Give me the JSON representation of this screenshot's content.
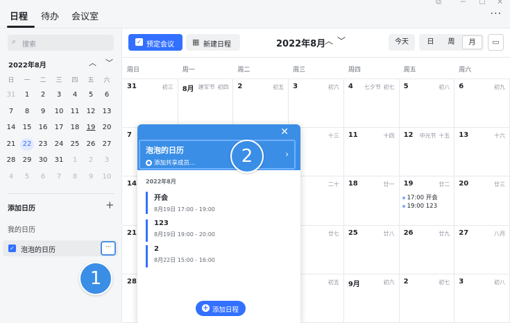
{
  "topbar": {
    "tabs": [
      "日程",
      "待办",
      "会议室"
    ],
    "more_label": "···"
  },
  "sidebar": {
    "search_placeholder": "搜索",
    "mini_month": "2022年8月",
    "weekdays": [
      "日",
      "一",
      "二",
      "三",
      "四",
      "五",
      "六"
    ],
    "weeks": [
      [
        "31",
        "1",
        "2",
        "3",
        "4",
        "5",
        "6"
      ],
      [
        "7",
        "8",
        "9",
        "10",
        "11",
        "12",
        "13"
      ],
      [
        "14",
        "15",
        "16",
        "17",
        "18",
        "19",
        "20"
      ],
      [
        "21",
        "22",
        "23",
        "24",
        "25",
        "26",
        "27"
      ],
      [
        "28",
        "29",
        "30",
        "31",
        "1",
        "2",
        "3"
      ],
      [
        "4",
        "5",
        "6",
        "7",
        "8",
        "9",
        "10"
      ]
    ],
    "selected_day": "22",
    "add_calendar_label": "添加日历",
    "my_calendars_label": "我的日历",
    "calendar_item": {
      "name": "泡泡的日历",
      "more": "···"
    }
  },
  "toolbar": {
    "book_meeting_label": "预定会议",
    "new_event_label": "新建日程",
    "month_title": "2022年8月",
    "today_label": "今天",
    "views": [
      "日",
      "周",
      "月"
    ],
    "active_view": "月"
  },
  "grid": {
    "weekday_headers": [
      "周日",
      "周一",
      "周二",
      "周三",
      "周四",
      "周五",
      "周六"
    ],
    "rows": [
      [
        {
          "d": "31",
          "l": "初三"
        },
        {
          "d": "8月",
          "f": "建军节",
          "l": "初四"
        },
        {
          "d": "2",
          "l": "初五"
        },
        {
          "d": "3",
          "l": "初六"
        },
        {
          "d": "4",
          "f": "七夕节",
          "l": "初七"
        },
        {
          "d": "5",
          "l": "初八"
        },
        {
          "d": "6",
          "l": "初九"
        }
      ],
      [
        {
          "d": "7",
          "l": ""
        },
        {
          "d": "",
          "l": ""
        },
        {
          "d": "",
          "l": ""
        },
        {
          "d": "",
          "l": "十三"
        },
        {
          "d": "11",
          "l": "十四"
        },
        {
          "d": "12",
          "f": "中元节",
          "l": "十五"
        },
        {
          "d": "13",
          "l": "十六"
        }
      ],
      [
        {
          "d": "14",
          "l": ""
        },
        {
          "d": "",
          "l": ""
        },
        {
          "d": "",
          "l": ""
        },
        {
          "d": "",
          "l": "二十"
        },
        {
          "d": "18",
          "l": "廿一"
        },
        {
          "d": "19",
          "l": "廿二",
          "events": [
            "17:00 开会",
            "19:00 123"
          ]
        },
        {
          "d": "20",
          "l": "廿三"
        }
      ],
      [
        {
          "d": "21",
          "l": ""
        },
        {
          "d": "",
          "l": ""
        },
        {
          "d": "",
          "l": ""
        },
        {
          "d": "",
          "l": "廿七"
        },
        {
          "d": "25",
          "l": "廿八"
        },
        {
          "d": "26",
          "l": "廿九"
        },
        {
          "d": "27",
          "l": "八月"
        }
      ],
      [
        {
          "d": "28",
          "l": ""
        },
        {
          "d": "",
          "l": ""
        },
        {
          "d": "",
          "l": ""
        },
        {
          "d": "",
          "l": "初五"
        },
        {
          "d": "9月",
          "l": "初六"
        },
        {
          "d": "2",
          "l": "初七"
        },
        {
          "d": "3",
          "l": "初八"
        }
      ]
    ]
  },
  "popup": {
    "title": "泡泡的日历",
    "subtitle": "添加共享成员...",
    "month": "2022年8月",
    "events": [
      {
        "title": "开会",
        "time": "8月19日 17:00 - 19:00"
      },
      {
        "title": "123",
        "time": "8月19日 19:00 - 20:00"
      },
      {
        "title": "2",
        "time": "8月22日 15:00 - 16:00"
      }
    ],
    "add_event_label": "添加日程"
  },
  "annotations": {
    "badge_1": "1",
    "badge_2": "2"
  },
  "colors": {
    "accent": "#3370ff",
    "popup_header": "#3a8ee6",
    "badge": "#3a8ee6"
  }
}
